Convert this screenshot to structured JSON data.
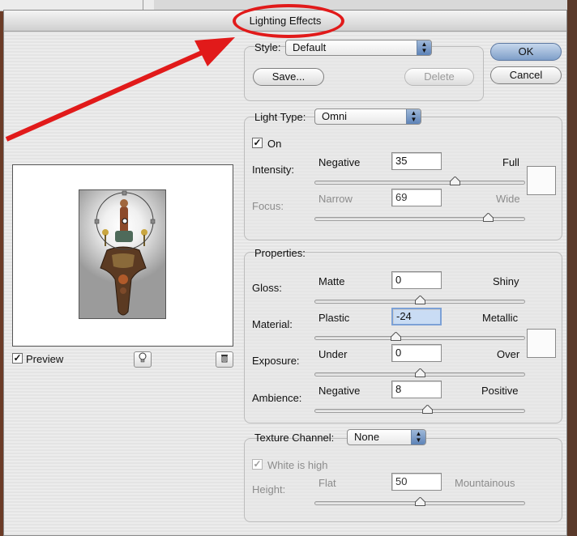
{
  "window": {
    "title": "Lighting Effects"
  },
  "style": {
    "label": "Style:",
    "value": "Default"
  },
  "buttons": {
    "ok": "OK",
    "cancel": "Cancel",
    "save": "Save...",
    "delete": "Delete"
  },
  "light_type": {
    "label": "Light Type:",
    "value": "Omni",
    "on_label": "On",
    "on_checked": true,
    "intensity": {
      "label": "Intensity:",
      "min_label": "Negative",
      "max_label": "Full",
      "value": "35"
    },
    "focus": {
      "label": "Focus:",
      "min_label": "Narrow",
      "max_label": "Wide",
      "value": "69"
    },
    "light_color": "#fbfbfb"
  },
  "properties": {
    "label": "Properties:",
    "gloss": {
      "label": "Gloss:",
      "min_label": "Matte",
      "max_label": "Shiny",
      "value": "0"
    },
    "material": {
      "label": "Material:",
      "min_label": "Plastic",
      "max_label": "Metallic",
      "value": "-24"
    },
    "exposure": {
      "label": "Exposure:",
      "min_label": "Under",
      "max_label": "Over",
      "value": "0"
    },
    "ambience": {
      "label": "Ambience:",
      "min_label": "Negative",
      "max_label": "Positive",
      "value": "8"
    },
    "ambient_color": "#fbfbfb"
  },
  "texture": {
    "label": "Texture Channel:",
    "value": "None",
    "white_is_high_label": "White is high",
    "white_is_high_checked": true,
    "height": {
      "label": "Height:",
      "min_label": "Flat",
      "max_label": "Mountainous",
      "value": "50"
    }
  },
  "preview": {
    "label": "Preview",
    "checked": true
  },
  "colors": {
    "annotation_red": "#e11a1a",
    "accent_blue": "#7f9fc9",
    "focus_field": "#c9dcf4"
  },
  "icons": {
    "light_bulb": "lightbulb-icon",
    "trash": "trash-icon"
  }
}
